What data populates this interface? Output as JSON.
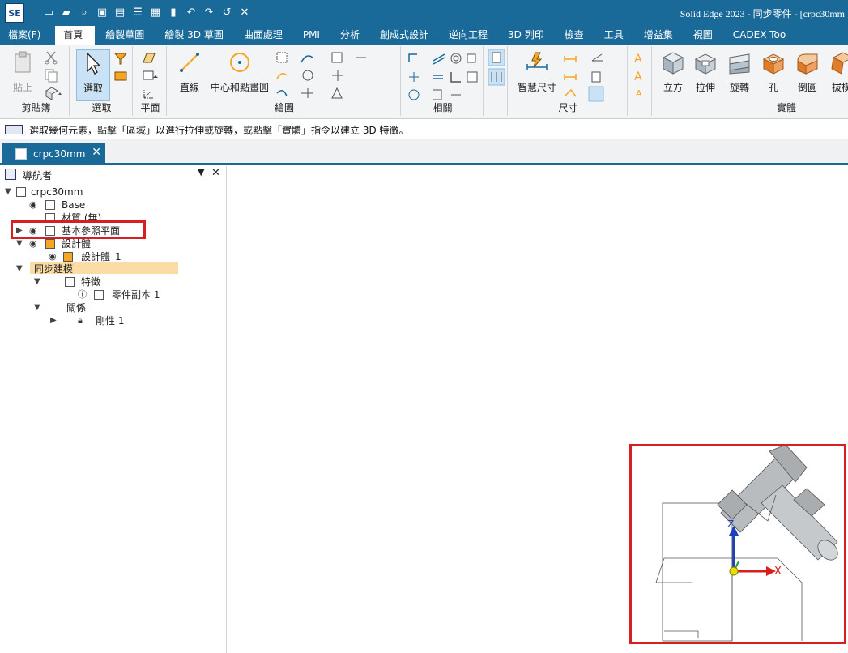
{
  "app": {
    "logo": "SE",
    "title": "Solid Edge 2023 - 同步零件 - [crpc30mm"
  },
  "quick_access": [
    "new-icon",
    "open-icon",
    "search-icon",
    "save-icon",
    "print-icon",
    "list-icon",
    "layout-icon",
    "clipboard-icon",
    "undo-icon",
    "redo-icon",
    "return-icon",
    "close-doc-icon"
  ],
  "menu": {
    "tabs": [
      "檔案(F)",
      "首頁",
      "繪製草圖",
      "繪製 3D 草圖",
      "曲面處理",
      "PMI",
      "分析",
      "創成式設計",
      "逆向工程",
      "3D 列印",
      "檢查",
      "工具",
      "增益集",
      "視圖",
      "CADEX Too"
    ],
    "active_index": 1
  },
  "ribbon": {
    "clipboard": {
      "label": "剪貼簿",
      "paste": "貼上"
    },
    "select": {
      "label": "選取",
      "button": "選取"
    },
    "plane": {
      "label": "平面"
    },
    "draw": {
      "label": "繪圖",
      "line": "直線",
      "circle": "中心和點畫圓"
    },
    "relate": {
      "label": "相關"
    },
    "dimension": {
      "label": "尺寸",
      "smart": "智慧尺寸"
    },
    "solid": {
      "label": "實體",
      "box": "立方",
      "extrude": "拉伸",
      "revolve": "旋轉",
      "hole": "孔",
      "round": "倒圓",
      "draft": "拔模"
    }
  },
  "hint": {
    "text": "選取幾何元素，點擊「區域」以進行拉伸或旋轉，或點擊「實體」指令以建立 3D 特徵。"
  },
  "document_tab": {
    "name": "crpc30mm",
    "close": "✕"
  },
  "navigator": {
    "title": "導航者",
    "pin": "▼",
    "close": "✕",
    "items": [
      {
        "label": "crpc30mm",
        "toggle": "▼",
        "eye": false
      },
      {
        "label": "Base",
        "toggle": "",
        "eye": true
      },
      {
        "label": "材質 (無)",
        "toggle": "",
        "eye": false
      },
      {
        "label": "基本參照平面",
        "toggle": "▶",
        "eye": true
      },
      {
        "label": "設計體",
        "toggle": "▼",
        "eye": true
      },
      {
        "label": "設計體_1",
        "toggle": "",
        "eye": true
      },
      {
        "label": "同步建模",
        "toggle": "▼",
        "eye": false
      },
      {
        "label": "特徵",
        "toggle": "▼",
        "eye": false
      },
      {
        "label": "零件副本 1",
        "toggle": "",
        "eye": false
      },
      {
        "label": "關係",
        "toggle": "▼",
        "eye": false
      },
      {
        "label": "剛性 1",
        "toggle": "▶",
        "eye": false
      }
    ]
  },
  "viewport": {
    "axis_z": "Z",
    "axis_x": "X",
    "colors": {
      "highlight": "#d81e1e",
      "axis_z": "#1f3fc2",
      "axis_x": "#d81e1e",
      "axis_y": "#2ca02c",
      "part": "#b8bcbf"
    }
  }
}
